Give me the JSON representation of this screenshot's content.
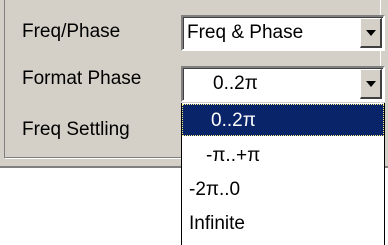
{
  "rows": [
    {
      "label": "Freq/Phase",
      "value": "Freq & Phase"
    },
    {
      "label": "Format Phase",
      "value": "0..2π"
    },
    {
      "label": "Freq Settling"
    }
  ],
  "dropdown": {
    "options": [
      "0..2π",
      "-π..+π",
      "-2π..0",
      "Infinite"
    ],
    "selected_index": 0
  },
  "icons": {
    "combo_arrow": "chevron-down-icon"
  },
  "colors": {
    "panel": "#d4d0c8",
    "selection": "#0a246a",
    "selection_text": "#ffffff"
  }
}
